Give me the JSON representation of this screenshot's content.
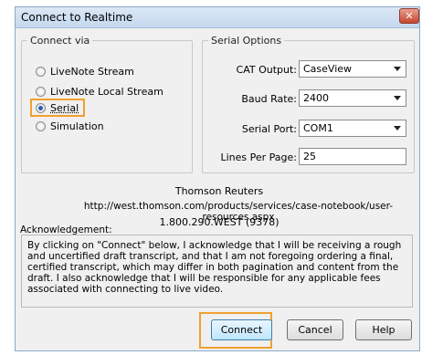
{
  "window": {
    "title": "Connect to Realtime",
    "close_glyph": "✕"
  },
  "connect_via": {
    "legend": "Connect via",
    "options": [
      {
        "label": "LiveNote Stream",
        "checked": false
      },
      {
        "label": "LiveNote Local Stream",
        "checked": false
      },
      {
        "label": "Serial",
        "checked": true
      },
      {
        "label": "Simulation",
        "checked": false
      }
    ]
  },
  "serial_options": {
    "legend": "Serial Options",
    "cat_output": {
      "label": "CAT Output:",
      "value": "CaseView"
    },
    "baud_rate": {
      "label": "Baud Rate:",
      "value": "2400"
    },
    "serial_port": {
      "label": "Serial Port:",
      "value": "COM1"
    },
    "lines_per_page": {
      "label": "Lines Per Page:",
      "value": "25"
    }
  },
  "info": {
    "company": "Thomson Reuters",
    "url": "http://west.thomson.com/products/services/case-notebook/user-resources.aspx",
    "phone": "1.800.290.WEST (9378)"
  },
  "acknowledgement": {
    "label": "Acknowledgement:",
    "text": "By clicking on \"Connect\" below, I acknowledge that I will be receiving a rough and uncertified draft transcript, and that I am not foregoing ordering a final, certified transcript, which may differ in both pagination and content from the draft.  I also acknowledge that I will be responsible for any applicable fees associated with connecting to live video."
  },
  "buttons": {
    "connect": "Connect",
    "cancel": "Cancel",
    "help": "Help"
  },
  "colors": {
    "highlight": "#f0a030",
    "title_bar": "#c4d8ee",
    "dialog_bg": "#f0f0f0"
  }
}
